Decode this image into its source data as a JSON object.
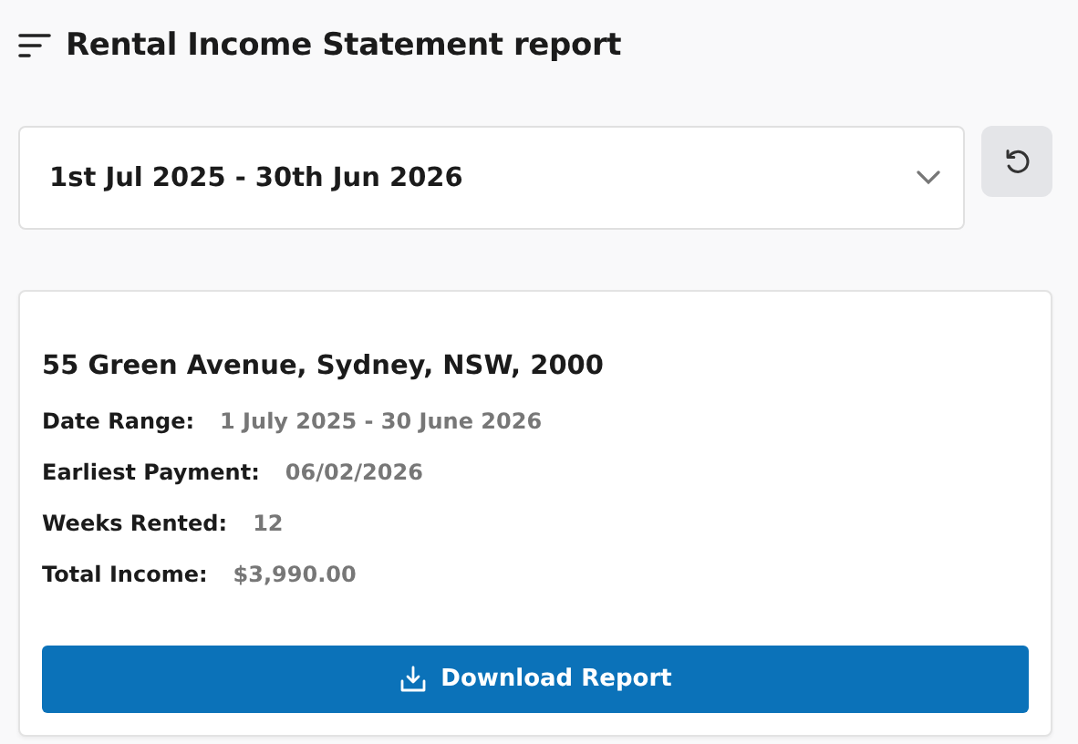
{
  "header": {
    "title": "Rental Income Statement report"
  },
  "date_select": {
    "value": "1st Jul 2025 - 30th Jun 2026"
  },
  "card": {
    "address": "55 Green Avenue, Sydney, NSW, 2000",
    "fields": [
      {
        "label": "Date Range:",
        "value": "1 July 2025 - 30 June 2026"
      },
      {
        "label": "Earliest Payment:",
        "value": "06/02/2026"
      },
      {
        "label": "Weeks Rented:",
        "value": "12"
      },
      {
        "label": "Total Income:",
        "value": "$3,990.00"
      }
    ],
    "button": "Download Report"
  }
}
